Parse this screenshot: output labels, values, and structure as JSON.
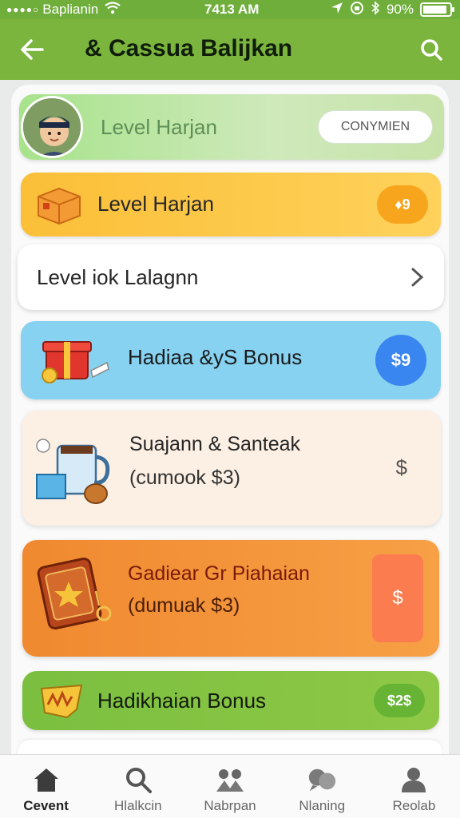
{
  "status_bar": {
    "signal": "●●●●○",
    "carrier": "Baplianin",
    "time": "7413 AM",
    "battery_text": "90%",
    "battery_level": 0.9
  },
  "header": {
    "title": "& Cassua Balijkan",
    "back_icon": "back-arrow-icon",
    "search_icon": "search-icon"
  },
  "cards": [
    {
      "label": "Level Harjan",
      "button": "CONYMIEN",
      "icon": "avatar"
    },
    {
      "label": "Level Harjan",
      "badge": "♦9",
      "icon": "box-icon"
    },
    {
      "label": "Level iok Lalagnn",
      "icon": "chevron-right-icon"
    },
    {
      "label": "Hadiaa &yS Bonus",
      "badge": "$9",
      "icon": "gift-box-icon"
    },
    {
      "label": "Suajann & Santeak",
      "sub": "(cumook $3)",
      "value": "$",
      "icon": "mug-icon"
    },
    {
      "label": "Gadiear Gr Piahaian",
      "sub": "(dumuak $3)",
      "value": "$",
      "icon": "badge-icon"
    },
    {
      "label": "Hadikhaian Bonus",
      "badge": "$2$",
      "icon": "crown-icon"
    }
  ],
  "bottom_nav": [
    {
      "label": "Cevent",
      "icon": "home-icon",
      "active": true
    },
    {
      "label": "Hlalkcin",
      "icon": "search-icon",
      "active": false
    },
    {
      "label": "Nabrpan",
      "icon": "people-icon",
      "active": false
    },
    {
      "label": "Nlaning",
      "icon": "chat-icon",
      "active": false
    },
    {
      "label": "Reolab",
      "icon": "profile-icon",
      "active": false
    }
  ],
  "colors": {
    "brand_green": "#7bb53d",
    "yellow": "#fbbf38",
    "blue": "#86d2f0",
    "cream": "#fcefe4",
    "orange": "#f08930",
    "green_card": "#7bbf40"
  }
}
